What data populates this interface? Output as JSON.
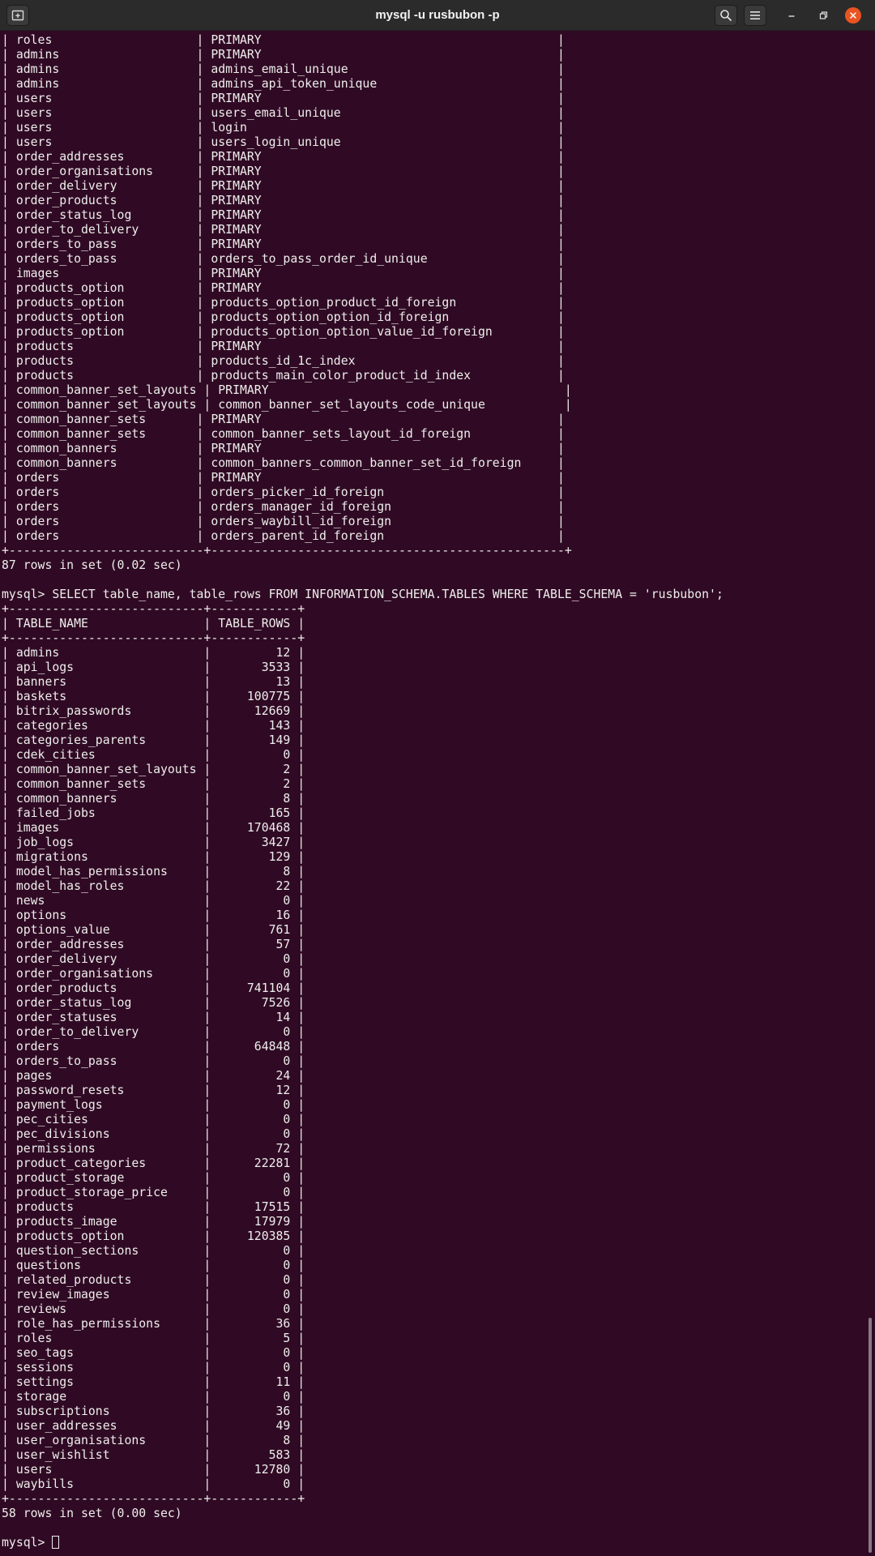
{
  "window": {
    "title": "mysql -u rusbubon -p",
    "icons": {
      "new_tab": "new-tab-icon",
      "search": "search-icon",
      "menu": "hamburger-menu-icon",
      "minimize": "minimize-icon",
      "maximize": "maximize-icon",
      "close": "close-icon"
    },
    "colors": {
      "background": "#300a24",
      "text": "#eeeeec",
      "titlebar": "#2b2b2b",
      "close": "#e95420"
    }
  },
  "terminal": {
    "lines": [
      "| roles                    | PRIMARY                                         |",
      "| admins                   | PRIMARY                                         |",
      "| admins                   | admins_email_unique                             |",
      "| admins                   | admins_api_token_unique                         |",
      "| users                    | PRIMARY                                         |",
      "| users                    | users_email_unique                              |",
      "| users                    | login                                           |",
      "| users                    | users_login_unique                              |",
      "| order_addresses          | PRIMARY                                         |",
      "| order_organisations      | PRIMARY                                         |",
      "| order_delivery           | PRIMARY                                         |",
      "| order_products           | PRIMARY                                         |",
      "| order_status_log         | PRIMARY                                         |",
      "| order_to_delivery        | PRIMARY                                         |",
      "| orders_to_pass           | PRIMARY                                         |",
      "| orders_to_pass           | orders_to_pass_order_id_unique                  |",
      "| images                   | PRIMARY                                         |",
      "| products_option          | PRIMARY                                         |",
      "| products_option          | products_option_product_id_foreign              |",
      "| products_option          | products_option_option_id_foreign               |",
      "| products_option          | products_option_option_value_id_foreign         |",
      "| products                 | PRIMARY                                         |",
      "| products                 | products_id_1c_index                            |",
      "| products                 | products_main_color_product_id_index            |",
      "| common_banner_set_layouts | PRIMARY                                         |",
      "| common_banner_set_layouts | common_banner_set_layouts_code_unique           |",
      "| common_banner_sets       | PRIMARY                                         |",
      "| common_banner_sets       | common_banner_sets_layout_id_foreign            |",
      "| common_banners           | PRIMARY                                         |",
      "| common_banners           | common_banners_common_banner_set_id_foreign     |",
      "| orders                   | PRIMARY                                         |",
      "| orders                   | orders_picker_id_foreign                        |",
      "| orders                   | orders_manager_id_foreign                       |",
      "| orders                   | orders_waybill_id_foreign                       |",
      "| orders                   | orders_parent_id_foreign                        |",
      "+---------------------------+-------------------------------------------------+",
      "87 rows in set (0.02 sec)",
      "",
      "mysql> SELECT table_name, table_rows FROM INFORMATION_SCHEMA.TABLES WHERE TABLE_SCHEMA = 'rusbubon';",
      "+---------------------------+------------+",
      "| TABLE_NAME                | TABLE_ROWS |",
      "+---------------------------+------------+",
      "| admins                    |         12 |",
      "| api_logs                  |       3533 |",
      "| banners                   |         13 |",
      "| baskets                   |     100775 |",
      "| bitrix_passwords          |      12669 |",
      "| categories                |        143 |",
      "| categories_parents        |        149 |",
      "| cdek_cities               |          0 |",
      "| common_banner_set_layouts |          2 |",
      "| common_banner_sets        |          2 |",
      "| common_banners            |          8 |",
      "| failed_jobs               |        165 |",
      "| images                    |     170468 |",
      "| job_logs                  |       3427 |",
      "| migrations                |        129 |",
      "| model_has_permissions     |          8 |",
      "| model_has_roles           |         22 |",
      "| news                      |          0 |",
      "| options                   |         16 |",
      "| options_value             |        761 |",
      "| order_addresses           |         57 |",
      "| order_delivery            |          0 |",
      "| order_organisations       |          0 |",
      "| order_products            |     741104 |",
      "| order_status_log          |       7526 |",
      "| order_statuses            |         14 |",
      "| order_to_delivery         |          0 |",
      "| orders                    |      64848 |",
      "| orders_to_pass            |          0 |",
      "| pages                     |         24 |",
      "| password_resets           |         12 |",
      "| payment_logs              |          0 |",
      "| pec_cities                |          0 |",
      "| pec_divisions             |          0 |",
      "| permissions               |         72 |",
      "| product_categories        |      22281 |",
      "| product_storage           |          0 |",
      "| product_storage_price     |          0 |",
      "| products                  |      17515 |",
      "| products_image            |      17979 |",
      "| products_option           |     120385 |",
      "| question_sections         |          0 |",
      "| questions                 |          0 |",
      "| related_products          |          0 |",
      "| review_images             |          0 |",
      "| reviews                   |          0 |",
      "| role_has_permissions      |         36 |",
      "| roles                     |          5 |",
      "| seo_tags                  |          0 |",
      "| sessions                  |          0 |",
      "| settings                  |         11 |",
      "| storage                   |          0 |",
      "| subscriptions             |         36 |",
      "| user_addresses            |         49 |",
      "| user_organisations        |          8 |",
      "| user_wishlist             |        583 |",
      "| users                     |      12780 |",
      "| waybills                  |          0 |",
      "+---------------------------+------------+",
      "58 rows in set (0.00 sec)",
      ""
    ],
    "prompt": "mysql> "
  }
}
